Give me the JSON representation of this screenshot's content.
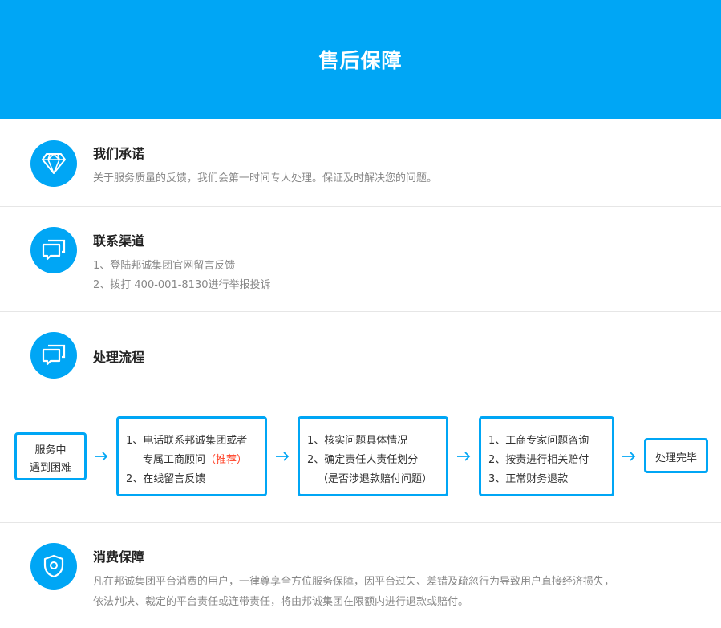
{
  "header": {
    "title": "售后保障"
  },
  "promise": {
    "icon": "diamond-icon",
    "title": "我们承诺",
    "text": "关于服务质量的反馈，我们会第一时间专人处理。保证及时解决您的问题。"
  },
  "contact": {
    "icon": "chat-bubbles-icon",
    "title": "联系渠道",
    "lines": [
      "1、登陆邦诚集团官网留言反馈",
      "2、拨打 400-001-8130进行举报投诉"
    ]
  },
  "process": {
    "icon": "chat-bubbles-icon",
    "title": "处理流程",
    "start": {
      "line1": "服务中",
      "line2": "遇到困难"
    },
    "step1": {
      "line1": "1、电话联系邦诚集团或者",
      "line2": "专属工商顾问",
      "line2_highlight": "（推荐）",
      "line3": "2、在线留言反馈"
    },
    "step2": {
      "line1": "1、核实问题具体情况",
      "line2": "2、确定责任人责任划分",
      "line3": "（是否涉退款赔付问题）"
    },
    "step3": {
      "line1": "1、工商专家问题咨询",
      "line2": "2、按责进行相关赔付",
      "line3": "3、正常财务退款"
    },
    "end": {
      "label": "处理完毕"
    },
    "accent_color": "#00a6f5",
    "highlight_color": "#ff3b1f"
  },
  "protect": {
    "icon": "shield-icon",
    "title": "消费保障",
    "lines": [
      "凡在邦诚集团平台消费的用户，一律尊享全方位服务保障，因平台过失、差错及疏忽行为导致用户直接经济损失，",
      "依法判决、裁定的平台责任或连带责任，将由邦诚集团在限额内进行退款或赔付。"
    ]
  },
  "theme": {
    "primary": "#00a6f5",
    "text_muted": "#888888"
  }
}
